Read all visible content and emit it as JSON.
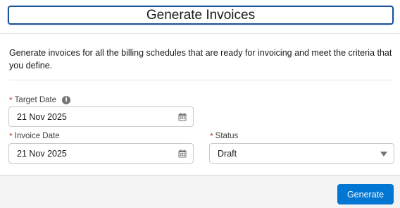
{
  "header": {
    "title": "Generate Invoices"
  },
  "description": "Generate invoices for all the billing schedules that are ready for invoicing and meet the criteria that you define.",
  "fields": {
    "target_date": {
      "label": "Target Date",
      "required_marker": "*",
      "value": "21 Nov 2025",
      "info_icon": "info-icon"
    },
    "invoice_date": {
      "label": "Invoice Date",
      "required_marker": "*",
      "value": "21 Nov 2025"
    },
    "status": {
      "label": "Status",
      "required_marker": "*",
      "value": "Draft"
    }
  },
  "footer": {
    "generate_label": "Generate"
  },
  "colors": {
    "brand": "#0176d3",
    "required": "#c23934",
    "title_border": "#1b5297"
  }
}
